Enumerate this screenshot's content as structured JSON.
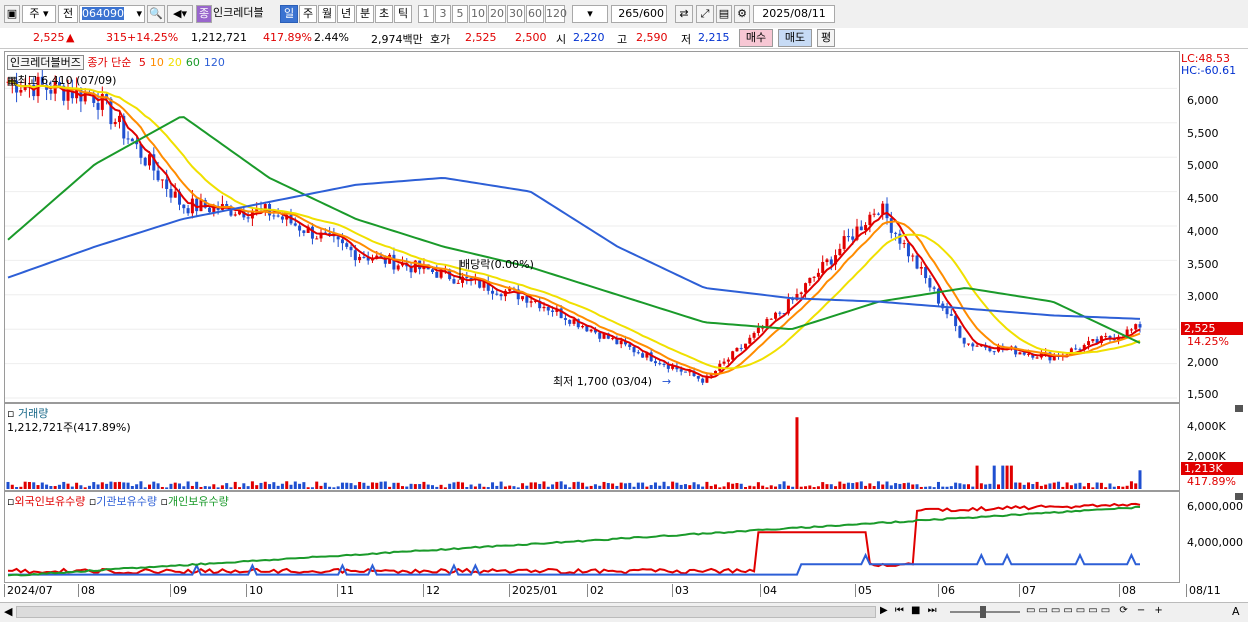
{
  "toolbar": {
    "type1": "주",
    "type2": "전",
    "code": "064090",
    "name": "인크레더블",
    "periods": [
      "일",
      "주",
      "월",
      "년",
      "분",
      "초",
      "틱"
    ],
    "selected_period": "일",
    "minutes": [
      "1",
      "3",
      "5",
      "10",
      "20",
      "30",
      "60",
      "120"
    ],
    "count": "265",
    "count_max": "/600",
    "date": "2025/08/11"
  },
  "quote": {
    "price": "2,525",
    "up_mark": "▲",
    "change": "315",
    "change_pct": "+14.25%",
    "volume": "1,212,721",
    "volume_ratio": "417.89%",
    "turnover": "2.44%",
    "amount": "2,974백만",
    "bid_label": "호가",
    "bid1": "2,525",
    "bid2": "2,500",
    "open_label": "시",
    "open": "2,220",
    "high_label": "고",
    "high": "2,590",
    "low_label": "저",
    "low": "2,215",
    "buy_btn": "매수",
    "sell_btn": "매도",
    "avg_btn": "평"
  },
  "price_pane": {
    "name": "인크레더블버즈",
    "ma_title": "종가 단순",
    "ma_periods": [
      "5",
      "10",
      "20",
      "60",
      "120"
    ],
    "ma_colors": [
      "#e00000",
      "#ff8c00",
      "#f0e000",
      "#1a9a2a",
      "#2d5fd6"
    ],
    "lc": "LC:48.53",
    "hc": "HC:-60.61",
    "high_label": "최고 6,410 (07/09)",
    "low_label": "최저 1,700 (03/04)",
    "div_label": "배당락(0.00%)",
    "last_price": "2,525",
    "last_pct": "14.25%",
    "yticks": [
      "6,000",
      "5,500",
      "5,000",
      "4,500",
      "4,000",
      "3,500",
      "3,000",
      "2,500",
      "2,000",
      "1,500"
    ]
  },
  "volume_pane": {
    "title": "거래량",
    "value": "1,212,721주(417.89%)",
    "yticks": [
      "4,000K",
      "2,000K"
    ],
    "last": "1,213K",
    "last_pct": "417.89%"
  },
  "holding_pane": {
    "series_names": [
      "외국인보유수량",
      "기관보유수량",
      "개인보유수량"
    ],
    "series_colors": [
      "#e00000",
      "#2d5fd6",
      "#1a9a2a"
    ],
    "yticks": [
      "6,000,000",
      "4,000,000"
    ]
  },
  "xaxis": {
    "labels": [
      "2024/07",
      "08",
      "09",
      "10",
      "11",
      "12",
      "2025/01",
      "02",
      "03",
      "04",
      "05",
      "06",
      "07",
      "08",
      "08/11"
    ]
  },
  "chart_data": {
    "type": "line",
    "title": "인크레더블버즈 일봉",
    "x": [
      "2024/07",
      "2024/08",
      "2024/09",
      "2024/10",
      "2024/11",
      "2024/12",
      "2025/01",
      "2025/02",
      "2025/03",
      "2025/04",
      "2025/05",
      "2025/06",
      "2025/07",
      "2025/08"
    ],
    "series": [
      {
        "name": "종가",
        "values": [
          6100,
          5900,
          4300,
          4200,
          3600,
          3300,
          2950,
          2300,
          1750,
          2900,
          4300,
          2300,
          2100,
          2525
        ]
      },
      {
        "name": "120",
        "values": [
          3250,
          3700,
          4100,
          4350,
          4600,
          4700,
          4500,
          3700,
          3100,
          2950,
          2900,
          2800,
          2700,
          2650
        ]
      },
      {
        "name": "60",
        "values": [
          3800,
          4900,
          5600,
          4700,
          4100,
          3700,
          3400,
          3000,
          2600,
          2500,
          2900,
          3100,
          2900,
          2300
        ]
      }
    ],
    "high": {
      "value": 6410,
      "date": "07/09"
    },
    "low": {
      "value": 1700,
      "date": "03/04"
    },
    "volume_last": 1212721,
    "ylim": [
      1500,
      6500
    ]
  }
}
